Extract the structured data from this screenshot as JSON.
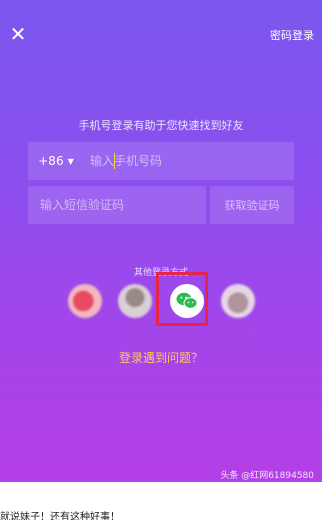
{
  "header": {
    "close_icon": "close-icon",
    "password_login": "密码登录"
  },
  "form": {
    "hint": "手机号登录有助于您快速找到好友",
    "country_code": "+86",
    "phone_placeholder": "输入手机号码",
    "code_placeholder": "输入短信验证码",
    "get_code": "获取验证码"
  },
  "social": {
    "label": "其他登录方式",
    "items": [
      "weibo-icon",
      "qq-icon",
      "wechat-icon",
      "other-login-icon"
    ],
    "highlight_color": "#e8244a"
  },
  "footer": {
    "trouble": "登录遇到问题？",
    "watermark": "头条 @红网61894580"
  },
  "caption": "就说妹子！还有这种好事！",
  "colors": {
    "gradient_top": "#7b57ee",
    "gradient_bottom": "#b43fe6",
    "cursor": "#ffd23f",
    "trouble_text": "#ffc95c"
  }
}
